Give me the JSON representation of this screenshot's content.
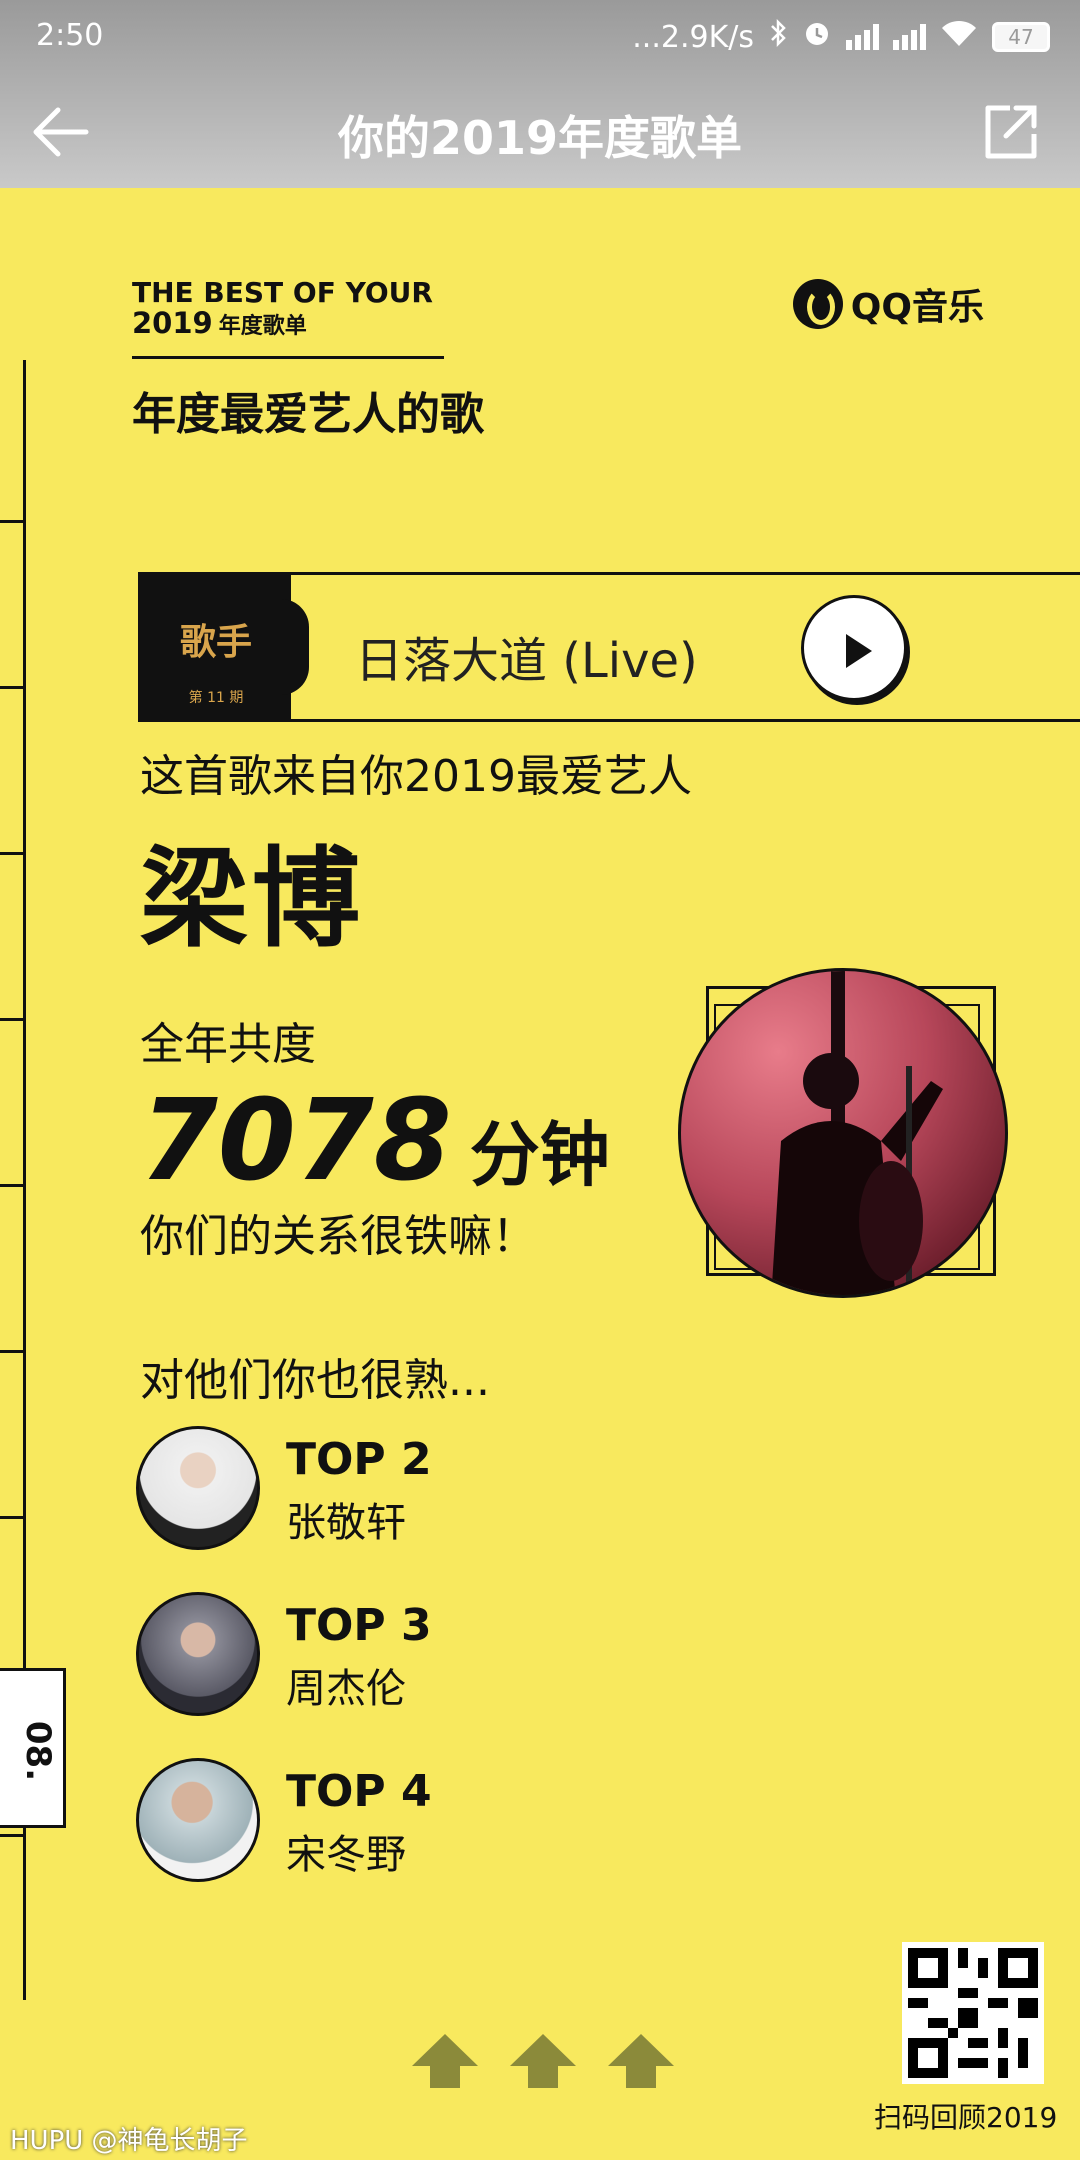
{
  "status_bar": {
    "time": "2:50",
    "net_speed": "...2.9K/s",
    "battery": "47"
  },
  "header": {
    "title": "你的2019年度歌单"
  },
  "brand": {
    "line1": "THE BEST OF YOUR",
    "year": "2019",
    "cn": "年度歌单",
    "app_name": "QQ音乐",
    "subtitle": "年度最爱艺人的歌"
  },
  "song": {
    "cover_text": "歌手",
    "cover_episode": "第 11 期",
    "title": "日落大道 (Live)"
  },
  "artist_section": {
    "from_text": "这首歌来自你2019最爱艺人",
    "artist_name": "梁博",
    "year_label": "全年共度",
    "minutes": "7078",
    "minutes_unit": "分钟",
    "relation_text": "你们的关系很铁嘛！"
  },
  "familiar": {
    "heading": "对他们你也很熟...",
    "items": [
      {
        "rank": "TOP 2",
        "name": "张敬轩"
      },
      {
        "rank": "TOP 3",
        "name": "周杰伦"
      },
      {
        "rank": "TOP 4",
        "name": "宋冬野"
      }
    ]
  },
  "side_tab": "08.",
  "qr_label": "扫码回顾2019",
  "watermark": "HUPU @神龟长胡子",
  "colors": {
    "background": "#f8e95e",
    "ink": "#111111",
    "header_gray": "#b0b0b0"
  }
}
